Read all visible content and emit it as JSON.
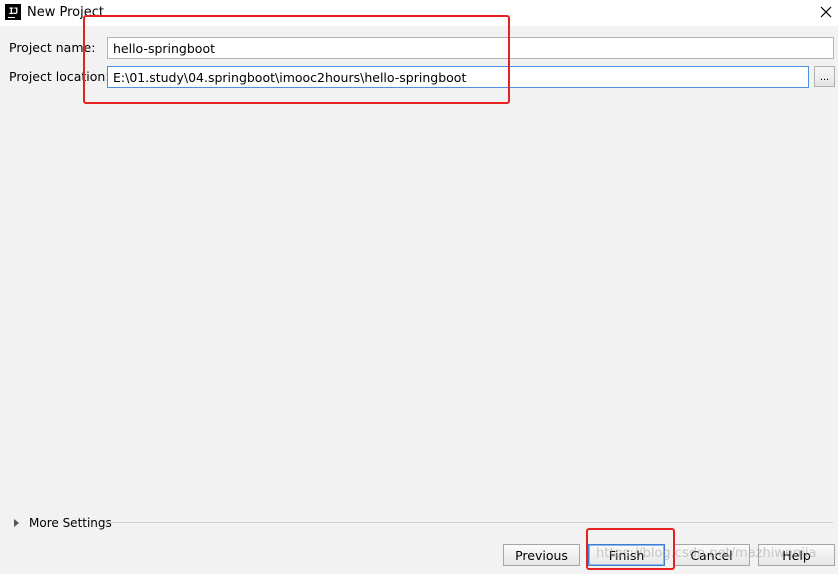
{
  "window": {
    "title": "New Project",
    "app_icon_text": "IJ"
  },
  "form": {
    "project_name": {
      "label": "Project name:",
      "value": "hello-springboot"
    },
    "project_location": {
      "label": "Project location:",
      "value": "E:\\01.study\\04.springboot\\imooc2hours\\hello-springboot",
      "browse_label": "..."
    }
  },
  "more_settings": {
    "label": "More Settings"
  },
  "buttons": {
    "previous_label": "Previous",
    "finish_label": "Finish",
    "cancel_label": "Cancel",
    "help_label": "Help"
  },
  "watermark": "https://blog.csdn.net/mazhiwenjia",
  "colors": {
    "highlight": "#e52222",
    "focus": "#4a90e2",
    "background": "#f2f2f2"
  },
  "icons": {
    "close": "close-icon",
    "expand": "triangle-right-icon"
  }
}
